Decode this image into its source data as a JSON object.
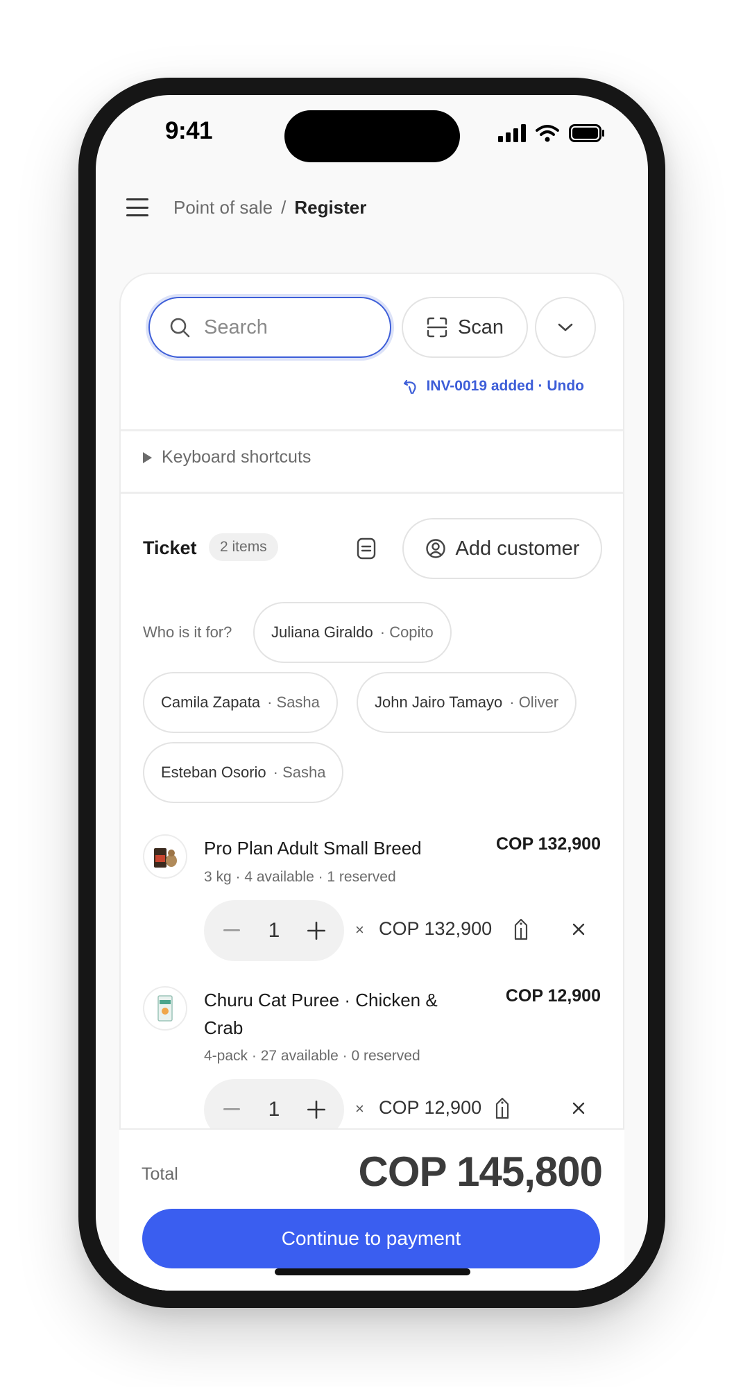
{
  "status_bar": {
    "time": "9:41"
  },
  "topbar": {
    "breadcrumb_parent": "Point of sale",
    "breadcrumb_separator": "/",
    "breadcrumb_current": "Register"
  },
  "search": {
    "placeholder": "Search",
    "value": ""
  },
  "scan_button": {
    "label": "Scan"
  },
  "undo_toast": {
    "text": "INV-0019 added · Undo"
  },
  "keyboard_shortcuts": {
    "label": "Keyboard shortcuts"
  },
  "ticket": {
    "title": "Ticket",
    "items_count": "2 items",
    "add_customer_label": "Add customer"
  },
  "customers": {
    "prompt": "Who is it for?",
    "chips": [
      {
        "name": "Juliana Giraldo",
        "pet": "· Copito"
      },
      {
        "name": "Camila Zapata",
        "pet": "· Sasha"
      },
      {
        "name": "John Jairo Tamayo",
        "pet": "· Oliver"
      },
      {
        "name": "Esteban Osorio",
        "pet": "· Sasha"
      }
    ]
  },
  "line_items": [
    {
      "name": "Pro Plan Adult Small Breed",
      "line_total": "COP 132,900",
      "meta": "3 kg · 4 available · 1 reserved",
      "quantity": "1",
      "times": "×",
      "unit_price": "COP 132,900"
    },
    {
      "name_line1": "Churu Cat Puree · Chicken &",
      "name_line2": "Crab",
      "line_total": "COP 12,900",
      "meta": "4-pack · 27 available · 0 reserved",
      "quantity": "1",
      "times": "×",
      "unit_price": "COP 12,900"
    }
  ],
  "footer": {
    "total_label": "Total",
    "total_value": "COP 145,800",
    "pay_button": "Continue to payment"
  },
  "colors": {
    "accent": "#3a5ef0",
    "link": "#3d5ed8",
    "text": "#1a1a1a",
    "muted": "#6b6b6b"
  }
}
